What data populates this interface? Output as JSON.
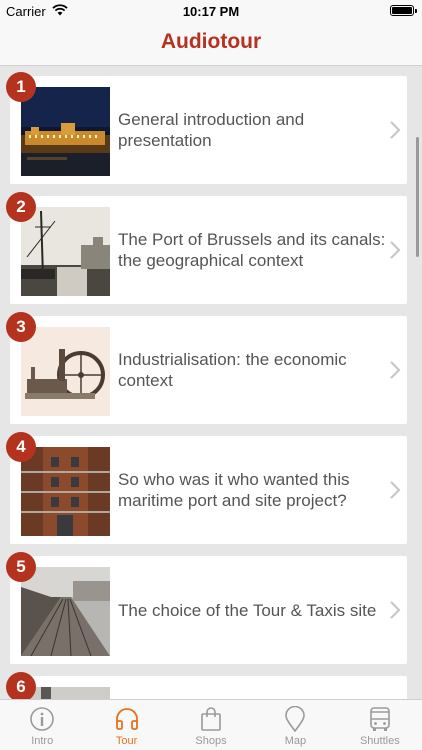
{
  "status_bar": {
    "carrier": "Carrier",
    "time": "10:17 PM"
  },
  "nav": {
    "title": "Audiotour"
  },
  "items": [
    {
      "number": "1",
      "title": "General introduction and presentation"
    },
    {
      "number": "2",
      "title": "The Port of Brussels and its canals: the geographical context"
    },
    {
      "number": "3",
      "title": "Industrialisation: the economic context"
    },
    {
      "number": "4",
      "title": "So who was it who wanted this maritime port and site project?"
    },
    {
      "number": "5",
      "title": "The choice of the Tour & Taxis site"
    },
    {
      "number": "6",
      "title": ""
    }
  ],
  "tabs": [
    {
      "label": "Intro",
      "icon": "info-icon",
      "active": false
    },
    {
      "label": "Tour",
      "icon": "headphones-icon",
      "active": true
    },
    {
      "label": "Shops",
      "icon": "bag-icon",
      "active": false
    },
    {
      "label": "Map",
      "icon": "map-pin-icon",
      "active": false
    },
    {
      "label": "Shuttles",
      "icon": "bus-icon",
      "active": false
    }
  ],
  "colors": {
    "accent": "#b5321e",
    "tab_active": "#e8701d",
    "tab_inactive": "#9a9a9a"
  }
}
